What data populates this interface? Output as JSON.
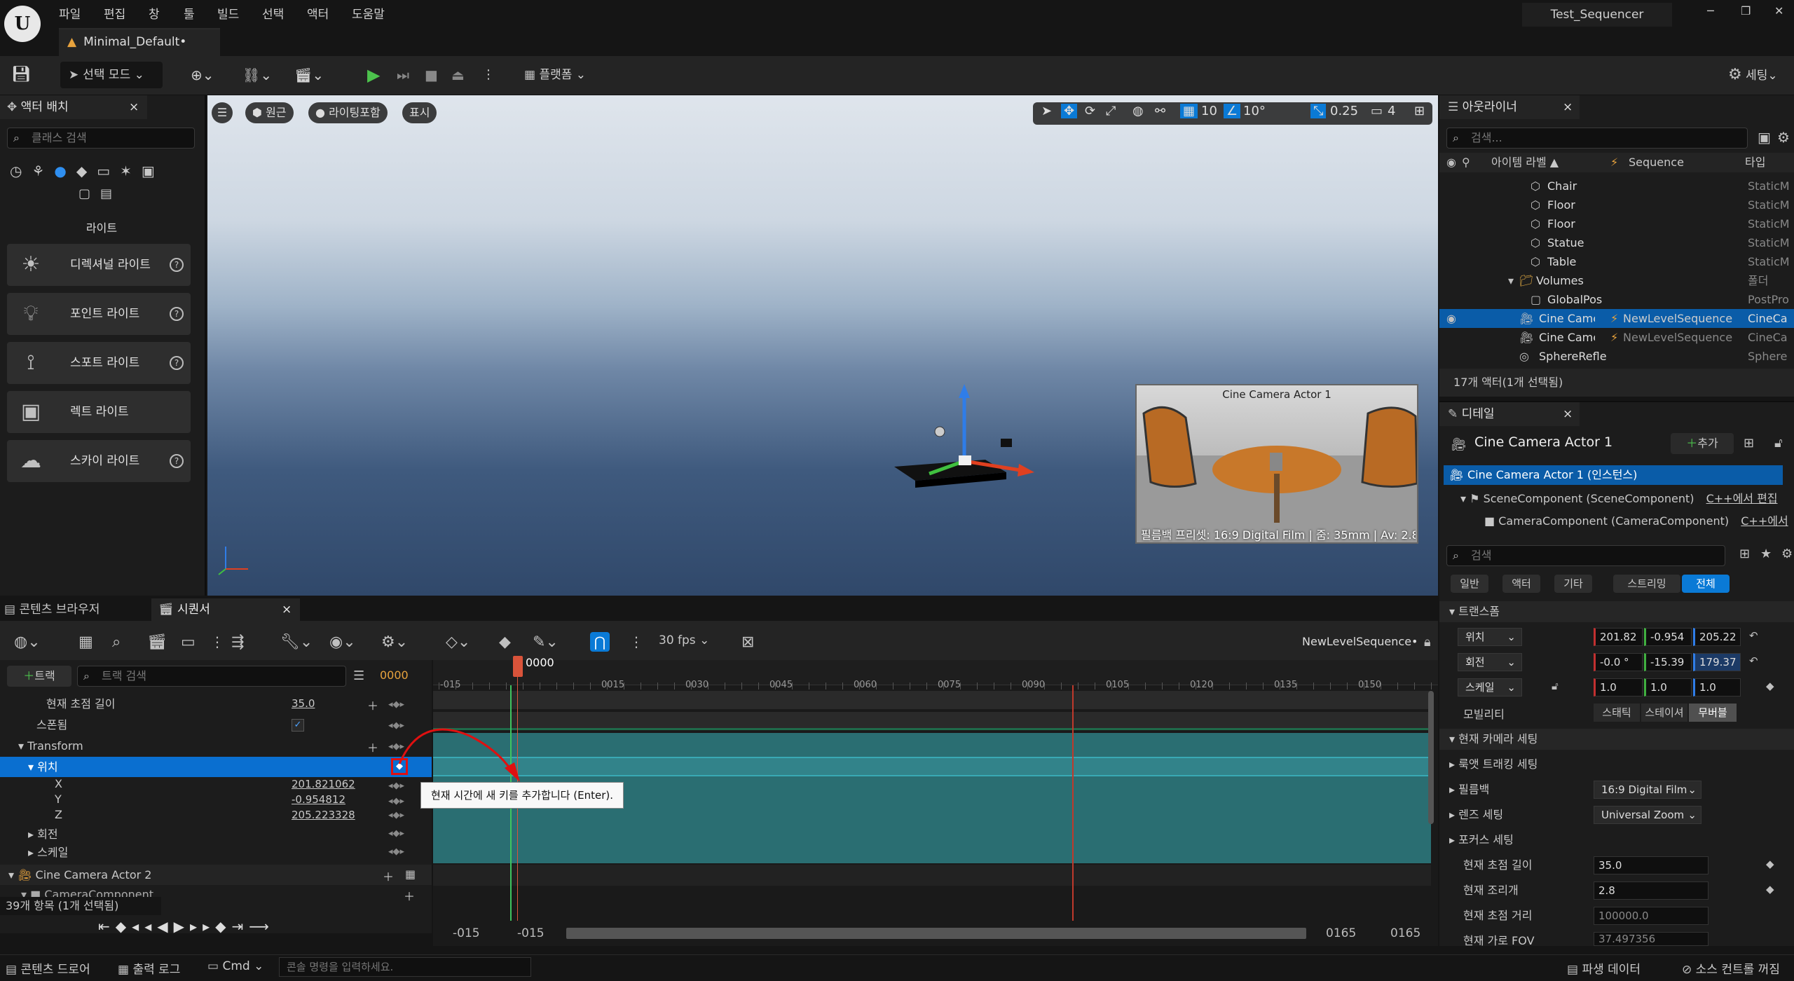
{
  "titlebar": {
    "menus": [
      "파일",
      "편집",
      "창",
      "툴",
      "빌드",
      "선택",
      "액터",
      "도움말"
    ],
    "project": "Test_Sequencer",
    "level_tab": "Minimal_Default•",
    "win_min": "─",
    "win_max": "❐",
    "win_close": "✕"
  },
  "toolbar": {
    "select_mode": "선택 모드",
    "platform": "플랫폼",
    "settings": "세팅"
  },
  "place_actors": {
    "title": "액터 배치",
    "close": "×",
    "search_placeholder": "클래스 검색",
    "category": "라이트",
    "items": [
      {
        "label": "디렉셔널 라이트",
        "icon": "sun-icon",
        "help": "?"
      },
      {
        "label": "포인트 라이트",
        "icon": "bulb-icon",
        "help": "?"
      },
      {
        "label": "스포트 라이트",
        "icon": "spotlight-icon",
        "help": "?"
      },
      {
        "label": "렉트 라이트",
        "icon": "rect-light-icon",
        "help": ""
      },
      {
        "label": "스카이 라이트",
        "icon": "skylight-icon",
        "help": "?"
      }
    ]
  },
  "viewport": {
    "perspective": "원근",
    "lighting": "라이팅포함",
    "show": "표시",
    "grid_snap": "10",
    "rot_snap": "10°",
    "scale_snap": "0.25",
    "cam_speed": "4",
    "preview_title": "Cine Camera Actor 1",
    "preview_caption": "필름백 프리셋: 16:9 Digital Film | 줌: 35mm | Av: 2.8"
  },
  "outliner": {
    "title": "아웃라이너",
    "close": "×",
    "search_placeholder": "검색...",
    "col_label": "아이템 라벨 ▲",
    "col_sequence": "Sequence",
    "col_type": "타입",
    "rows": [
      {
        "name": "Chair",
        "seq": "",
        "type": "StaticM"
      },
      {
        "name": "Floor",
        "seq": "",
        "type": "StaticM"
      },
      {
        "name": "Floor",
        "seq": "",
        "type": "StaticM"
      },
      {
        "name": "Statue",
        "seq": "",
        "type": "StaticM"
      },
      {
        "name": "Table",
        "seq": "",
        "type": "StaticM"
      },
      {
        "name": "Volumes",
        "seq": "",
        "type": "폴더"
      },
      {
        "name": "GlobalPos",
        "seq": "",
        "type": "PostPro"
      },
      {
        "name": "Cine Camera",
        "seq": "NewLevelSequence",
        "type": "CineCa"
      },
      {
        "name": "Cine Camera",
        "seq": "NewLevelSequence",
        "type": "CineCa"
      },
      {
        "name": "SphereRefle",
        "seq": "",
        "type": "Sphere"
      }
    ],
    "footer": "17개 액터(1개 선택됨)"
  },
  "details": {
    "title": "디테일",
    "close": "×",
    "actor_name": "Cine Camera Actor 1",
    "add": "추가",
    "instance": "Cine Camera Actor 1 (인스턴스)",
    "scene_component": "SceneComponent (SceneComponent)",
    "scene_link": "C++에서 편집",
    "camera_component": "CameraComponent (CameraComponent)",
    "camera_link": "C++에서",
    "search_placeholder": "검색",
    "filters": [
      "일반",
      "액터",
      "기타",
      "스트리밍",
      "전체"
    ],
    "transform_header": "트랜스폼",
    "location_label": "위치",
    "location": [
      "201.82",
      "-0.954",
      "205.22"
    ],
    "rotation_label": "회전",
    "rotation": [
      "-0.0 °",
      "-15.39",
      "179.37"
    ],
    "scale_label": "스케일",
    "scale": [
      "1.0",
      "1.0",
      "1.0"
    ],
    "mobility_label": "모빌리티",
    "mobility": [
      "스태틱",
      "스테이셔",
      "무버블"
    ],
    "camera_settings_header": "현재 카메라 세팅",
    "lookat": "룩앳 트래킹 세팅",
    "filmback_label": "필름백",
    "filmback_value": "16:9 Digital Film",
    "lens_label": "렌즈 세팅",
    "lens_value": "Universal Zoom",
    "focus_label": "포커스 세팅",
    "focal_length_label": "현재 초점 길이",
    "focal_length": "35.0",
    "aperture_label": "현재 조리개",
    "aperture": "2.8",
    "focus_distance_label": "현재 초점 거리",
    "focus_distance": "100000.0",
    "hfov_label": "현재 가로 FOV",
    "hfov": "37.497356"
  },
  "sequencer": {
    "tab_content": "콘텐츠 브라우저",
    "tab_seq": "시퀀서",
    "tab_close": "×",
    "fps": "30 fps",
    "sequence_name": "NewLevelSequence•",
    "add_track": "트랙",
    "track_search": "트랙 검색",
    "current_frame": "0000",
    "playhead_label": "0000",
    "ruler": [
      "-015",
      "0015",
      "0030",
      "0045",
      "0060",
      "0075",
      "0090",
      "0105",
      "0120",
      "0135",
      "0150"
    ],
    "tracks": {
      "focal_length_label": "현재 초점 길이",
      "focal_length_value": "35.0",
      "spawned_label": "스폰됨",
      "transform_label": "Transform",
      "location_label": "위치",
      "x_label": "X",
      "x_value": "201.821062",
      "y_label": "Y",
      "y_value": "-0.954812",
      "z_label": "Z",
      "z_value": "205.223328",
      "rotation_label": "회전",
      "scale_label": "스케일",
      "actor2_label": "Cine Camera Actor 2",
      "camcomp_label": "CameraComponent"
    },
    "tooltip": "현재 시간에 새 키를 추가합니다 (Enter).",
    "items_count": "39개 항목 (1개 선택됨)",
    "range_start1": "-015",
    "range_start2": "-015",
    "range_end1": "0165",
    "range_end2": "0165"
  },
  "statusbar": {
    "content_drawer": "콘텐츠 드로어",
    "output_log": "출력 로그",
    "cmd": "Cmd",
    "console_placeholder": "콘솔 명령을 입력하세요.",
    "derived_data": "파생 데이터",
    "source_control": "소스 컨트롤 꺼짐"
  },
  "colors": {
    "accent": "#0a7ad6",
    "key_green": "#2db84a",
    "playhead": "#d9533a",
    "track_teal": "#2a6e72"
  }
}
